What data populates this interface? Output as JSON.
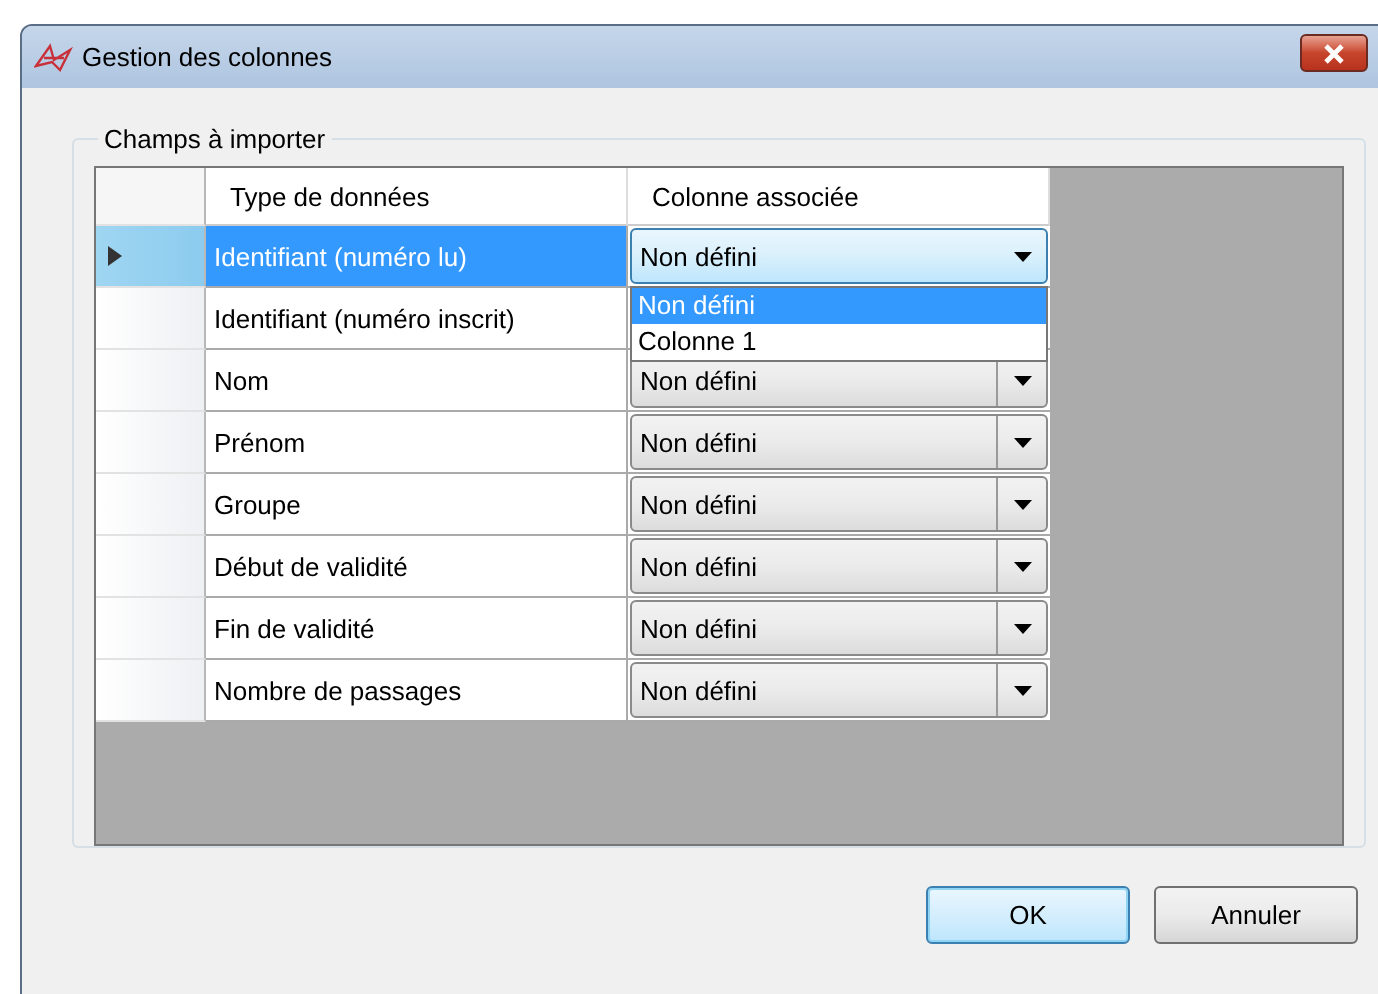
{
  "window": {
    "title": "Gestion des colonnes"
  },
  "group": {
    "title": "Champs à importer"
  },
  "grid": {
    "columns": [
      "Type de données",
      "Colonne associée"
    ],
    "rows": [
      {
        "type": "Identifiant (numéro lu)",
        "column": "Non défini",
        "selected": true,
        "options": [
          {
            "label": "Non défini",
            "selected": true
          },
          {
            "label": "Colonne 1",
            "selected": false
          }
        ]
      },
      {
        "type": "Identifiant (numéro inscrit)",
        "selected": false
      },
      {
        "type": "Nom",
        "column": "Non défini",
        "selected": false
      },
      {
        "type": "Prénom",
        "column": "Non défini",
        "selected": false
      },
      {
        "type": "Groupe",
        "column": "Non défini",
        "selected": false
      },
      {
        "type": "Début de validité",
        "column": "Non défini",
        "selected": false
      },
      {
        "type": "Fin de validité",
        "column": "Non défini",
        "selected": false
      },
      {
        "type": "Nombre de passages",
        "column": "Non défini",
        "selected": false
      }
    ]
  },
  "buttons": [
    {
      "label": "OK",
      "default": true
    },
    {
      "label": "Annuler",
      "default": false
    }
  ]
}
